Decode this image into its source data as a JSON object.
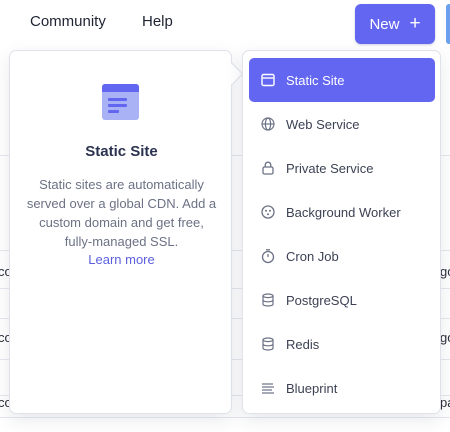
{
  "nav": {
    "community": "Community",
    "help": "Help",
    "new_button": {
      "label": "New",
      "icon": "plus-icon"
    }
  },
  "background": {
    "row_fragments_left": [
      "co",
      "co",
      "co"
    ],
    "row_fragments_right": [
      "go",
      "go",
      "pa"
    ]
  },
  "description": {
    "icon": "static-site-browser-icon",
    "title": "Static Site",
    "body": "Static sites are automatically served over a global CDN. Add a custom domain and get free, fully-managed SSL.",
    "link": "Learn more"
  },
  "menu": {
    "items": [
      {
        "label": "Static Site",
        "icon": "browser-window-icon",
        "active": true
      },
      {
        "label": "Web Service",
        "icon": "globe-icon",
        "active": false
      },
      {
        "label": "Private Service",
        "icon": "lock-icon",
        "active": false
      },
      {
        "label": "Background Worker",
        "icon": "worker-cog-icon",
        "active": false
      },
      {
        "label": "Cron Job",
        "icon": "stopwatch-icon",
        "active": false
      },
      {
        "label": "PostgreSQL",
        "icon": "database-icon",
        "active": false
      },
      {
        "label": "Redis",
        "icon": "database-icon",
        "active": false
      },
      {
        "label": "Blueprint",
        "icon": "blueprint-lines-icon",
        "active": false
      }
    ]
  },
  "colors": {
    "accent": "#6366f1",
    "link": "#5b5fe0",
    "title": "#2b3350",
    "muted_text": "#6b7285",
    "icon_light": "#a8b2f5"
  }
}
